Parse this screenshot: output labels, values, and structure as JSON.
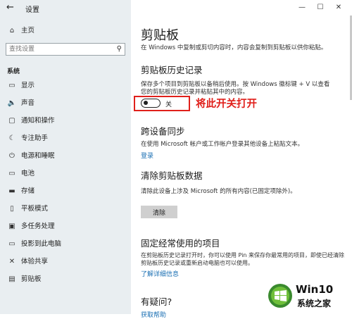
{
  "window": {
    "title": "设置",
    "controls": [
      "—",
      "☐",
      "✕"
    ]
  },
  "sidebar": {
    "home_label": "主页",
    "search_placeholder": "查找设置",
    "section": "系统",
    "items": [
      {
        "icon": "display-icon",
        "glyph": "▭",
        "label": "显示"
      },
      {
        "icon": "sound-icon",
        "glyph": "🔈",
        "label": "声音"
      },
      {
        "icon": "notifications-icon",
        "glyph": "▢",
        "label": "通知和操作"
      },
      {
        "icon": "focus-assist-icon",
        "glyph": "☾",
        "label": "专注助手"
      },
      {
        "icon": "power-icon",
        "glyph": "⏻",
        "label": "电源和睡眠"
      },
      {
        "icon": "battery-icon",
        "glyph": "▭",
        "label": "电池"
      },
      {
        "icon": "storage-icon",
        "glyph": "▬",
        "label": "存储"
      },
      {
        "icon": "tablet-mode-icon",
        "glyph": "▯",
        "label": "平板模式"
      },
      {
        "icon": "multitasking-icon",
        "glyph": "▣",
        "label": "多任务处理"
      },
      {
        "icon": "projecting-icon",
        "glyph": "▭",
        "label": "投影到此电脑"
      },
      {
        "icon": "shared-experiences-icon",
        "glyph": "✕",
        "label": "体验共享"
      },
      {
        "icon": "clipboard-icon",
        "glyph": "▤",
        "label": "剪贴板"
      }
    ]
  },
  "main": {
    "title": "剪贴板",
    "intro": "在 Windows 中复制或剪切内容时，内容会复制到剪贴板以供你粘贴。",
    "history": {
      "heading": "剪贴板历史记录",
      "desc_line1": "保存多个项目到剪贴板以备稍后使用。按 Windows 徽标键 + V 以查看",
      "desc_line2": "您的剪贴板历史记录并粘贴其中的内容。",
      "toggle_state": "关",
      "annotation": "将此开关打开"
    },
    "sync": {
      "heading": "跨设备同步",
      "desc": "在使用 Microsoft 帐户或工作帐户登录其他设备上粘贴文本。",
      "link": "登录"
    },
    "clear": {
      "heading": "清除剪贴板数据",
      "desc": "清除此设备上涉及 Microsoft 的所有内容(已固定项除外)。",
      "button": "清除"
    },
    "pinned": {
      "heading": "固定经常使用的项目",
      "desc_line1": "在剪贴板历史记录打开时，你可以使用 Pin 来保存你最常用的项目，即使已经清除",
      "desc_line2": "剪贴板历史记录或重新启动电脑也可以使用。",
      "link": "了解详细信息"
    },
    "question": {
      "heading": "有疑问?",
      "link": "获取帮助"
    }
  },
  "watermark": {
    "title": "Win10",
    "subtitle": "系统之家"
  },
  "colors": {
    "accent": "#1a6fb3",
    "annotation": "#e0201b",
    "sidebar_bg": "#e9eef1"
  }
}
